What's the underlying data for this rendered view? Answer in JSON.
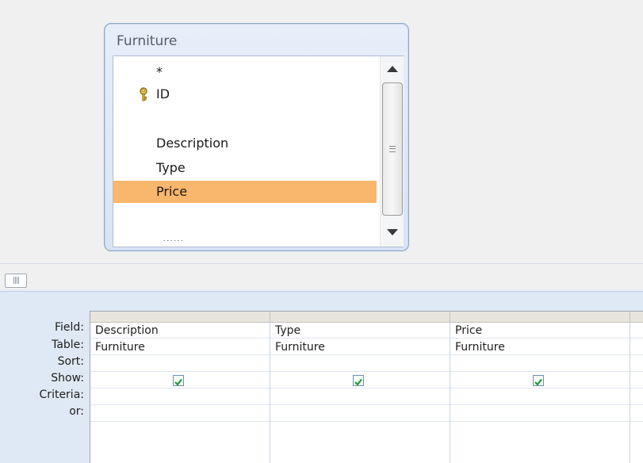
{
  "query_design": {
    "table_window": {
      "title": "Furniture",
      "fields": [
        "*",
        "ID",
        "Description",
        "Type",
        "Price"
      ],
      "primary_key_field": "ID",
      "selected_field": "Price",
      "partial_field_text": "......"
    },
    "grid": {
      "row_labels": {
        "field": "Field:",
        "table": "Table:",
        "sort": "Sort:",
        "show": "Show:",
        "criteria": "Criteria:",
        "or": "or:"
      },
      "columns": [
        {
          "field": "Description",
          "table": "Furniture",
          "sort": "",
          "show": true,
          "criteria": "",
          "or": ""
        },
        {
          "field": "Type",
          "table": "Furniture",
          "sort": "",
          "show": true,
          "criteria": "",
          "or": ""
        },
        {
          "field": "Price",
          "table": "Furniture",
          "sort": "",
          "show": true,
          "criteria": "",
          "or": ""
        }
      ]
    },
    "colors": {
      "selected_field": "#f9b66d",
      "window_border": "#8aa6c9",
      "grid_background": "#dfe9f5",
      "checkbox_check": "#1e9a3a"
    },
    "icons": {
      "key": "key-icon",
      "scroll_up": "triangle-up-icon",
      "scroll_down": "triangle-down-icon",
      "splitter": "grip-icon",
      "show_checkbox": "checkmark-icon"
    }
  }
}
